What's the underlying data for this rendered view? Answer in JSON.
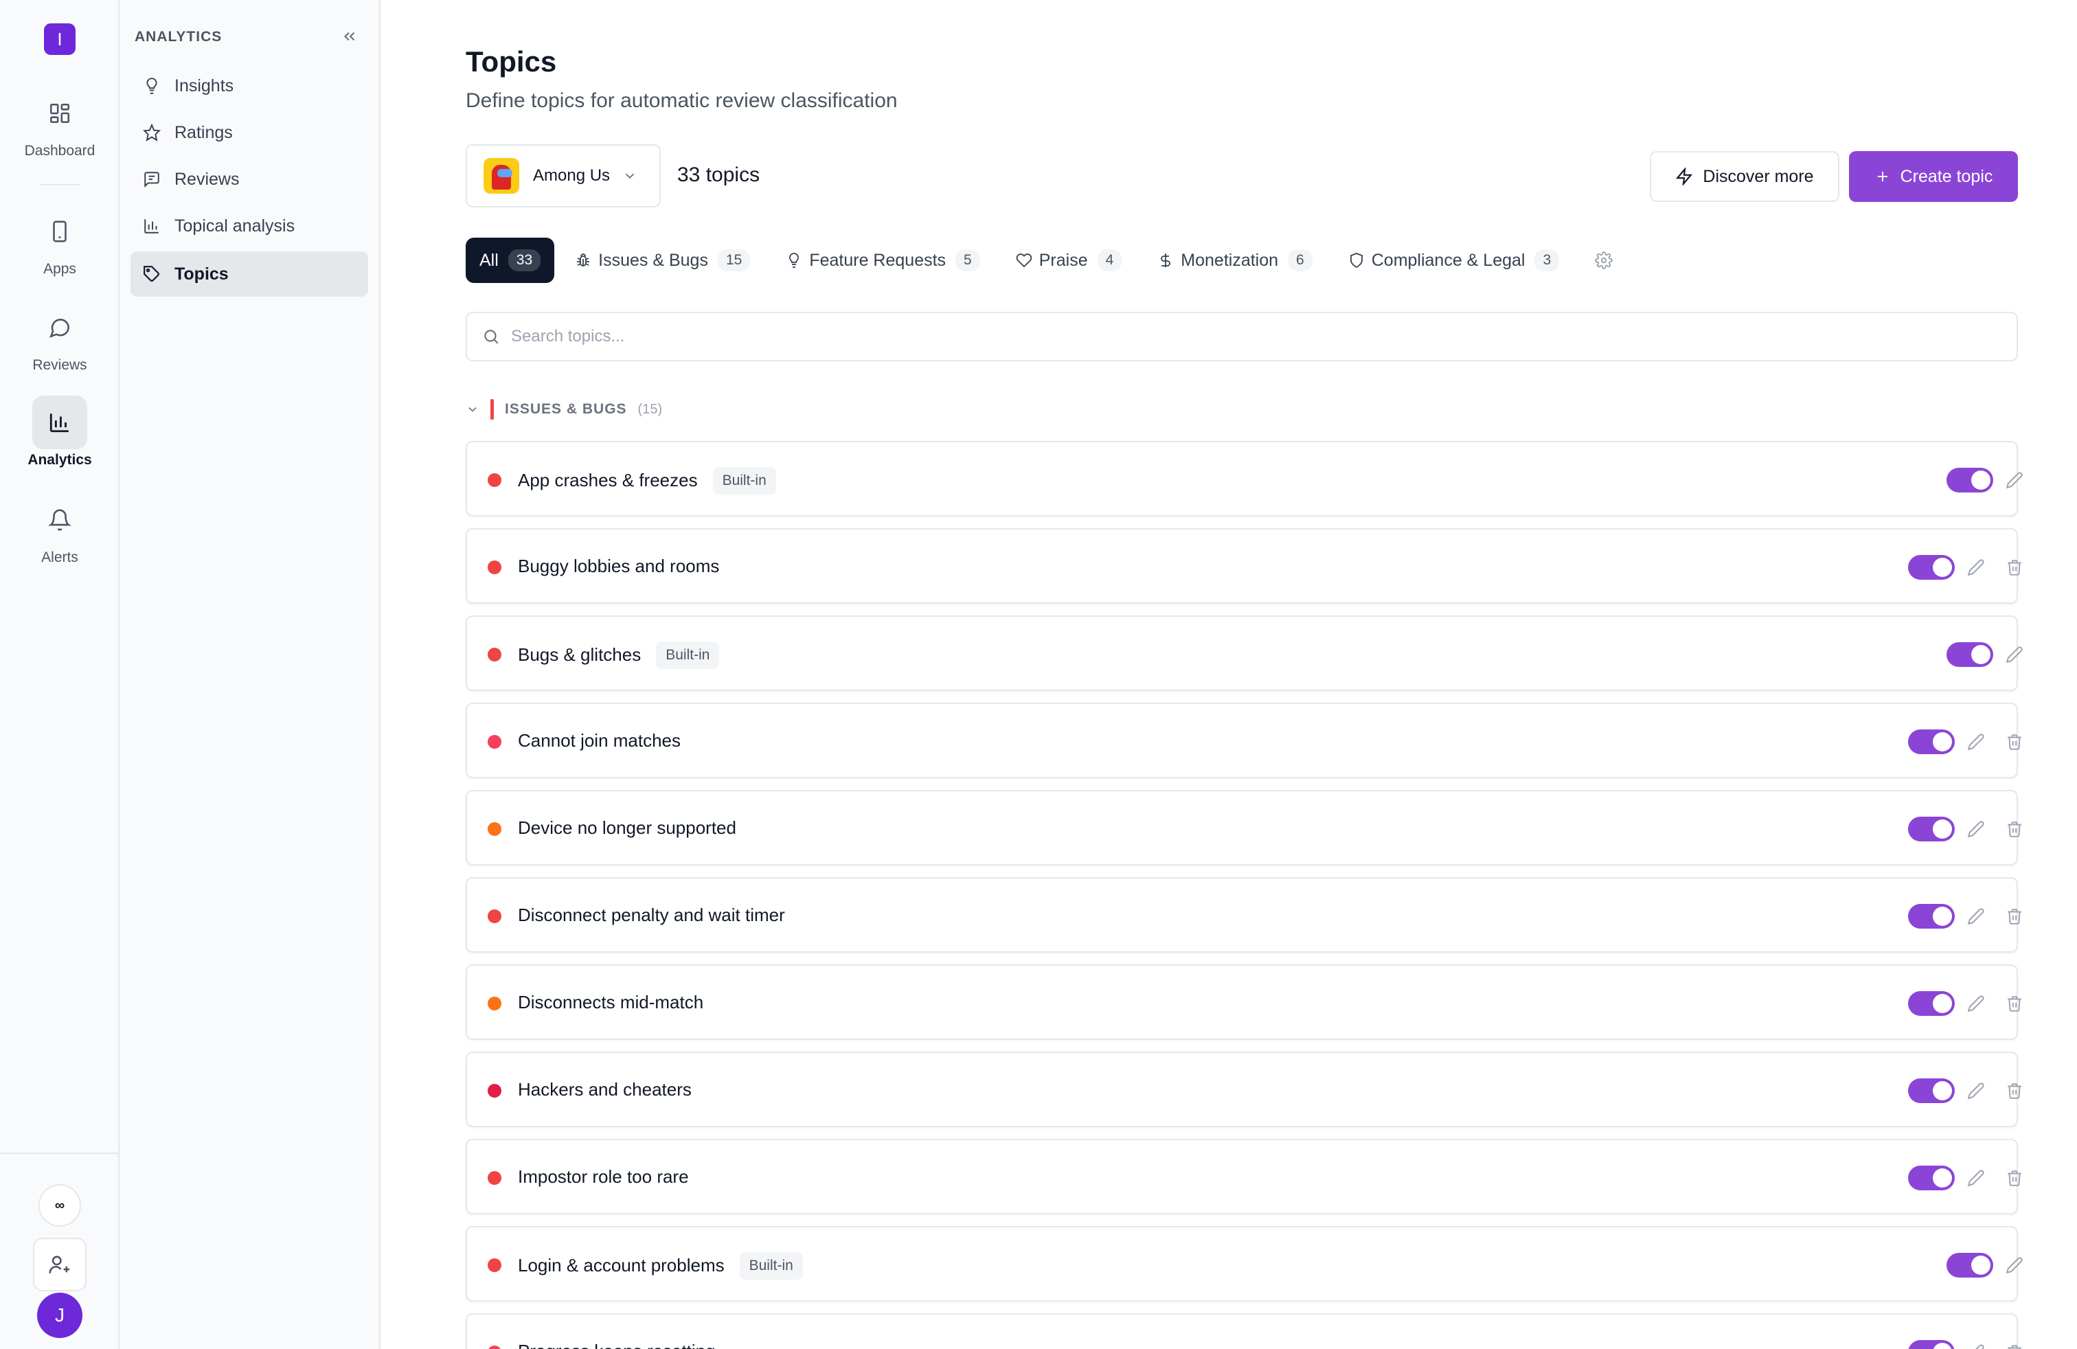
{
  "rail": {
    "logo_letter": "I",
    "items": [
      {
        "label": "Dashboard"
      },
      {
        "label": "Apps"
      },
      {
        "label": "Reviews"
      },
      {
        "label": "Analytics"
      },
      {
        "label": "Alerts"
      }
    ],
    "infinity": "∞",
    "avatar_letter": "J"
  },
  "subnav": {
    "title": "ANALYTICS",
    "items": [
      {
        "label": "Insights"
      },
      {
        "label": "Ratings"
      },
      {
        "label": "Reviews"
      },
      {
        "label": "Topical analysis"
      },
      {
        "label": "Topics"
      }
    ]
  },
  "header": {
    "title": "Topics",
    "subtitle": "Define topics for automatic review classification",
    "app_name": "Among Us",
    "topic_count": "33 topics",
    "discover_label": "Discover more",
    "create_label": "Create topic"
  },
  "filters": [
    {
      "label": "All",
      "count": "33"
    },
    {
      "label": "Issues & Bugs",
      "count": "15"
    },
    {
      "label": "Feature Requests",
      "count": "5"
    },
    {
      "label": "Praise",
      "count": "4"
    },
    {
      "label": "Monetization",
      "count": "6"
    },
    {
      "label": "Compliance & Legal",
      "count": "3"
    }
  ],
  "search": {
    "placeholder": "Search topics..."
  },
  "group": {
    "name": "ISSUES & BUGS",
    "count": "(15)",
    "color": "#ef4444"
  },
  "topics": [
    {
      "name": "App crashes & freezes",
      "badge": "Built-in",
      "color": "#ef4444",
      "enabled": true
    },
    {
      "name": "Buggy lobbies and rooms",
      "badge": "",
      "color": "#ef4444",
      "enabled": true
    },
    {
      "name": "Bugs & glitches",
      "badge": "Built-in",
      "color": "#ef4444",
      "enabled": true
    },
    {
      "name": "Cannot join matches",
      "badge": "",
      "color": "#f43f5e",
      "enabled": true
    },
    {
      "name": "Device no longer supported",
      "badge": "",
      "color": "#f97316",
      "enabled": true
    },
    {
      "name": "Disconnect penalty and wait timer",
      "badge": "",
      "color": "#ef4444",
      "enabled": true
    },
    {
      "name": "Disconnects mid-match",
      "badge": "",
      "color": "#f97316",
      "enabled": true
    },
    {
      "name": "Hackers and cheaters",
      "badge": "",
      "color": "#e11d48",
      "enabled": true
    },
    {
      "name": "Impostor role too rare",
      "badge": "",
      "color": "#ef4444",
      "enabled": true
    },
    {
      "name": "Login & account problems",
      "badge": "Built-in",
      "color": "#ef4444",
      "enabled": true
    },
    {
      "name": "Progress keeps resetting",
      "badge": "",
      "color": "#f43f5e",
      "enabled": true
    }
  ],
  "colors": {
    "accent": "#8b45d6",
    "brand": "#6d28d9",
    "active_filter": "#0f172a"
  }
}
